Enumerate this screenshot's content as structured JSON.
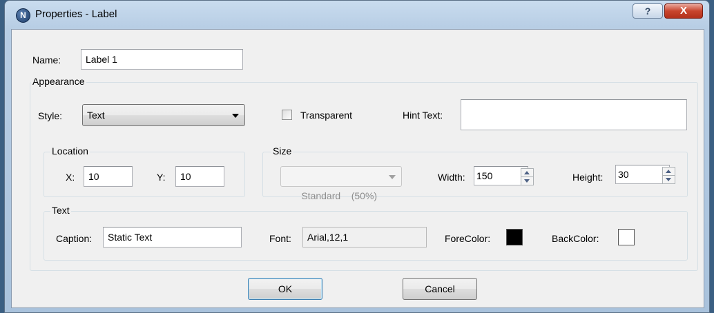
{
  "window": {
    "title": "Properties - Label",
    "app_icon_letter": "N",
    "help_glyph": "?",
    "close_glyph": "X"
  },
  "name_field": {
    "label": "Name:",
    "value": "Label 1"
  },
  "appearance": {
    "title": "Appearance",
    "style": {
      "label": "Style:",
      "value": "Text"
    },
    "transparent": {
      "label": "Transparent",
      "checked": false
    },
    "hint_text": {
      "label": "Hint Text:",
      "value": ""
    }
  },
  "location": {
    "title": "Location",
    "x": {
      "label": "X:",
      "value": "10"
    },
    "y": {
      "label": "Y:",
      "value": "10"
    }
  },
  "size": {
    "title": "Size",
    "preset": {
      "value": "Standard    (50%)"
    },
    "width": {
      "label": "Width:",
      "value": "150"
    },
    "height": {
      "label": "Height:",
      "value": "30"
    }
  },
  "text": {
    "title": "Text",
    "caption": {
      "label": "Caption:",
      "value": "Static Text"
    },
    "font": {
      "label": "Font:",
      "value": "Arial,12,1"
    },
    "forecolor": {
      "label": "ForeColor:",
      "color": "#000000"
    },
    "backcolor": {
      "label": "BackColor:",
      "color": "#ffffff"
    }
  },
  "buttons": {
    "ok": "OK",
    "cancel": "Cancel"
  },
  "colors": {
    "titlebar": "#b7cde4",
    "dialog_bg": "#f0f0f0",
    "close_red": "#c8452e"
  }
}
